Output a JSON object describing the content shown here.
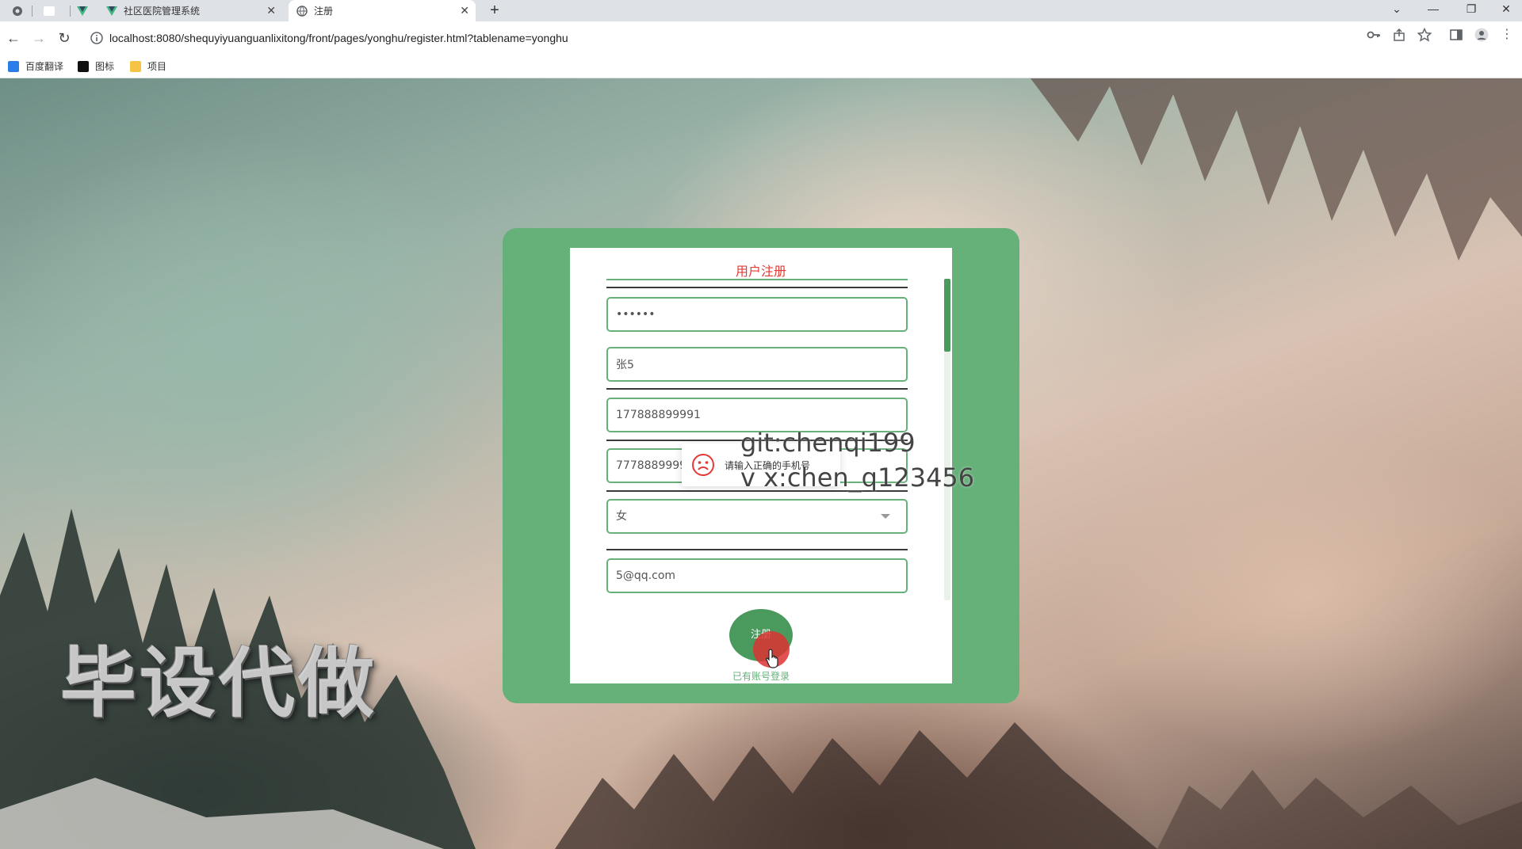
{
  "browser": {
    "tabs": [
      {
        "label": "社区医院管理系统"
      },
      {
        "label": "注册"
      }
    ],
    "url": "localhost:8080/shequyiyuanguanlixitong/front/pages/yonghu/register.html?tablename=yonghu",
    "bookmarks": [
      {
        "label": "百度翻译",
        "color": "#2b7de9"
      },
      {
        "label": "图标",
        "color": "#111111"
      },
      {
        "label": "项目",
        "color": "#f6c445"
      }
    ]
  },
  "form": {
    "title": "用户注册",
    "password_value": "••••••",
    "name_value": "张5",
    "phone_value": "177888899991",
    "idcard_value": "7778889999",
    "gender_value": "女",
    "email_value": "5@qq.com",
    "register_label": "注册",
    "login_link": "已有账号登录"
  },
  "toast": {
    "message": "请输入正确的手机号"
  },
  "overlay": {
    "watermark": "毕设代做",
    "line1": "git:chenqi199",
    "line2": "v x:chen_q123456"
  },
  "colors": {
    "accent": "#66b07a",
    "accent_dark": "#4a9a5d",
    "title": "#e53935",
    "error": "#e53935"
  }
}
